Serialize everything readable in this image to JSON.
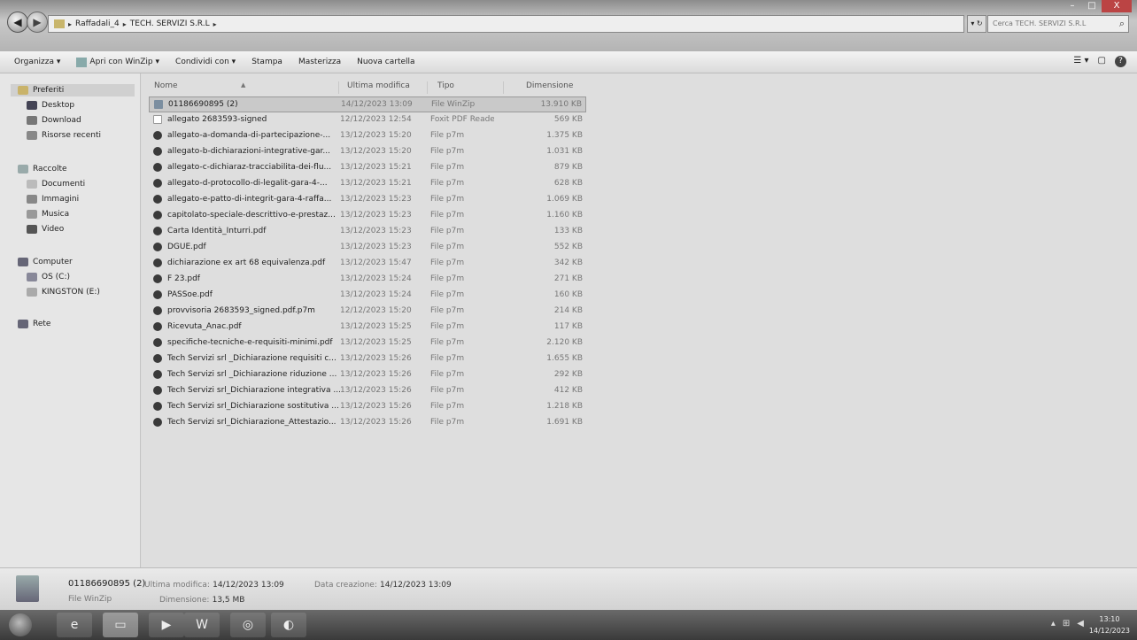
{
  "address": {
    "crumbs": [
      "Raffadali_4",
      "TECH. SERVIZI S.R.L"
    ],
    "search_placeholder": "Cerca TECH. SERVIZI S.R.L"
  },
  "window_controls": {
    "minimize": "–",
    "maximize": "□",
    "close": "X"
  },
  "command_bar": {
    "organize": "Organizza ▾",
    "open_with": "Apri con WinZip ▾",
    "share": "Condividi con ▾",
    "print": "Stampa",
    "burn": "Masterizza",
    "new_folder": "Nuova cartella"
  },
  "nav": {
    "favorites": "Preferiti",
    "desktop": "Desktop",
    "download": "Download",
    "recent": "Risorse recenti",
    "libraries": "Raccolte",
    "documents": "Documenti",
    "pictures": "Immagini",
    "music": "Musica",
    "video": "Video",
    "computer": "Computer",
    "os_drive": "OS (C:)",
    "usb_drive": "KINGSTON (E:)",
    "network": "Rete"
  },
  "columns": {
    "name": "Nome",
    "modified": "Ultima modifica",
    "type": "Tipo",
    "size": "Dimensione"
  },
  "files": [
    {
      "name": "01186690895 (2)",
      "modified": "14/12/2023 13:09",
      "type": "File WinZip",
      "size": "13.910 KB",
      "icon": "zip"
    },
    {
      "name": "allegato 2683593-signed",
      "modified": "12/12/2023 12:54",
      "type": "Foxit PDF Reader ...",
      "size": "569 KB",
      "icon": "pdf"
    },
    {
      "name": "allegato-a-domanda-di-partecipazione-...",
      "modified": "13/12/2023 15:20",
      "type": "File p7m",
      "size": "1.375 KB",
      "icon": "p7m"
    },
    {
      "name": "allegato-b-dichiarazioni-integrative-gar...",
      "modified": "13/12/2023 15:20",
      "type": "File p7m",
      "size": "1.031 KB",
      "icon": "p7m"
    },
    {
      "name": "allegato-c-dichiaraz-tracciabilita-dei-flu...",
      "modified": "13/12/2023 15:21",
      "type": "File p7m",
      "size": "879 KB",
      "icon": "p7m"
    },
    {
      "name": "allegato-d-protocollo-di-legalit-gara-4-...",
      "modified": "13/12/2023 15:21",
      "type": "File p7m",
      "size": "628 KB",
      "icon": "p7m"
    },
    {
      "name": "allegato-e-patto-di-integrit-gara-4-raffa...",
      "modified": "13/12/2023 15:23",
      "type": "File p7m",
      "size": "1.069 KB",
      "icon": "p7m"
    },
    {
      "name": "capitolato-speciale-descrittivo-e-prestaz...",
      "modified": "13/12/2023 15:23",
      "type": "File p7m",
      "size": "1.160 KB",
      "icon": "p7m"
    },
    {
      "name": "Carta Identità_Inturri.pdf",
      "modified": "13/12/2023 15:23",
      "type": "File p7m",
      "size": "133 KB",
      "icon": "p7m"
    },
    {
      "name": "DGUE.pdf",
      "modified": "13/12/2023 15:23",
      "type": "File p7m",
      "size": "552 KB",
      "icon": "p7m"
    },
    {
      "name": "dichiarazione ex art 68 equivalenza.pdf",
      "modified": "13/12/2023 15:47",
      "type": "File p7m",
      "size": "342 KB",
      "icon": "p7m"
    },
    {
      "name": "F 23.pdf",
      "modified": "13/12/2023 15:24",
      "type": "File p7m",
      "size": "271 KB",
      "icon": "p7m"
    },
    {
      "name": "PASSoe.pdf",
      "modified": "13/12/2023 15:24",
      "type": "File p7m",
      "size": "160 KB",
      "icon": "p7m"
    },
    {
      "name": "provvisoria 2683593_signed.pdf.p7m",
      "modified": "12/12/2023 15:20",
      "type": "File p7m",
      "size": "214 KB",
      "icon": "p7m"
    },
    {
      "name": "Ricevuta_Anac.pdf",
      "modified": "13/12/2023 15:25",
      "type": "File p7m",
      "size": "117 KB",
      "icon": "p7m"
    },
    {
      "name": "specifiche-tecniche-e-requisiti-minimi.pdf",
      "modified": "13/12/2023 15:25",
      "type": "File p7m",
      "size": "2.120 KB",
      "icon": "p7m"
    },
    {
      "name": "Tech Servizi srl _Dichiarazione requisiti c...",
      "modified": "13/12/2023 15:26",
      "type": "File p7m",
      "size": "1.655 KB",
      "icon": "p7m"
    },
    {
      "name": "Tech Servizi srl _Dichiarazione riduzione ...",
      "modified": "13/12/2023 15:26",
      "type": "File p7m",
      "size": "292 KB",
      "icon": "p7m"
    },
    {
      "name": "Tech Servizi srl_Dichiarazione integrativa ...",
      "modified": "13/12/2023 15:26",
      "type": "File p7m",
      "size": "412 KB",
      "icon": "p7m"
    },
    {
      "name": "Tech Servizi srl_Dichiarazione sostitutiva ...",
      "modified": "13/12/2023 15:26",
      "type": "File p7m",
      "size": "1.218 KB",
      "icon": "p7m"
    },
    {
      "name": "Tech Servizi srl_Dichiarazione_Attestazio...",
      "modified": "13/12/2023 15:26",
      "type": "File p7m",
      "size": "1.691 KB",
      "icon": "p7m"
    }
  ],
  "details": {
    "name": "01186690895 (2)",
    "type": "File WinZip",
    "modified_label": "Ultima modifica:",
    "modified_value": "14/12/2023 13:09",
    "size_label": "Dimensione:",
    "size_value": "13,5 MB",
    "created_label": "Data creazione:",
    "created_value": "14/12/2023 13:09"
  },
  "taskbar": {
    "time": "13:10",
    "date": "14/12/2023",
    "word_label": "W"
  }
}
